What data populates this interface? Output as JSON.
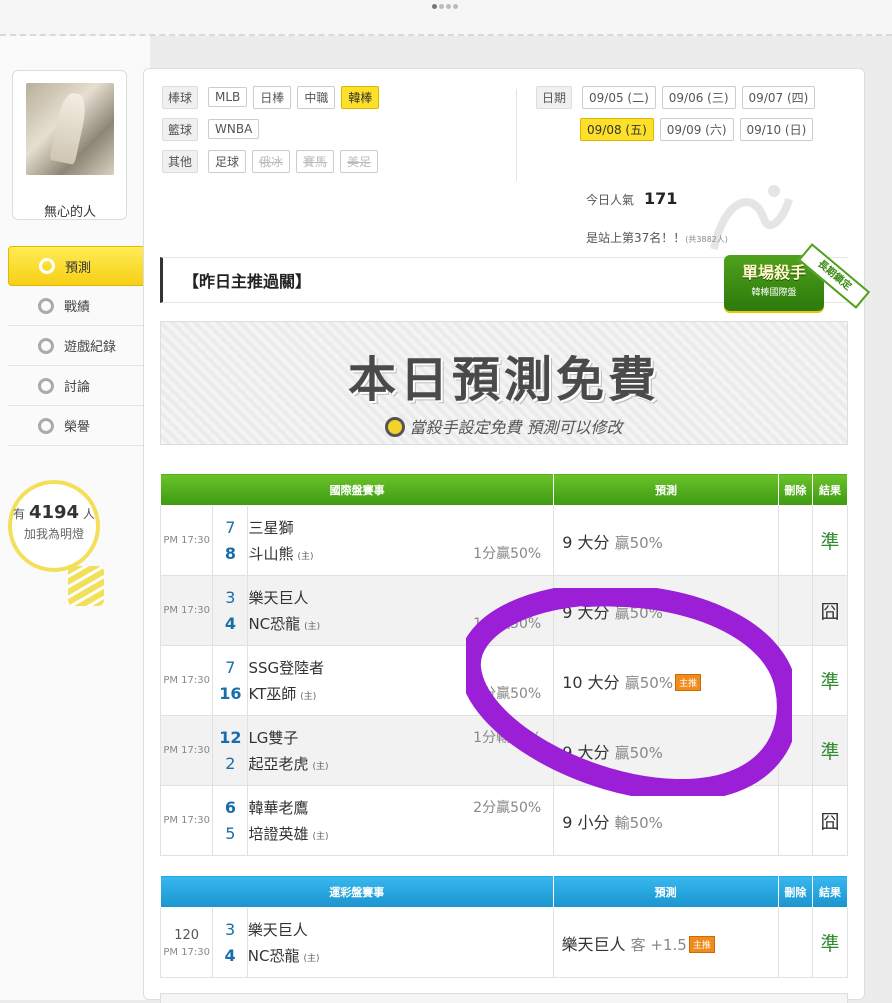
{
  "user": {
    "name": "無心的人"
  },
  "sidebar": {
    "items": [
      {
        "label": "預測",
        "icon": "target-icon",
        "active": true
      },
      {
        "label": "戰績",
        "icon": "trophy-icon",
        "active": false
      },
      {
        "label": "遊戲紀錄",
        "icon": "record-icon",
        "active": false
      },
      {
        "label": "討論",
        "icon": "discuss-icon",
        "active": false
      },
      {
        "label": "榮譽",
        "icon": "medal-icon",
        "active": false
      }
    ],
    "fans": {
      "prefix": "有",
      "count": "4194",
      "suffix": "人",
      "action": "加我為明燈"
    }
  },
  "filters": {
    "baseball": {
      "label": "棒球",
      "tags": [
        "MLB",
        "日棒",
        "中職",
        "韓棒"
      ],
      "selected": "韓棒"
    },
    "basketball": {
      "label": "籃球",
      "tags": [
        "WNBA"
      ]
    },
    "other": {
      "label": "其他",
      "tags": [
        "足球",
        "俄冰",
        "賽馬",
        "美足"
      ],
      "disabled": [
        "俄冰",
        "賽馬",
        "美足"
      ]
    }
  },
  "dates": {
    "label": "日期",
    "row1": [
      "09/05 (二)",
      "09/06 (三)",
      "09/07 (四)"
    ],
    "row2": [
      "09/08 (五)",
      "09/09 (六)",
      "09/10 (日)"
    ],
    "selected": "09/08 (五)"
  },
  "stats": {
    "popularity_label": "今日人氣",
    "popularity": "171",
    "rank_text": "是站上第37名！！",
    "rank_note": "(共3882人)"
  },
  "section": {
    "title": "【昨日主推過關】"
  },
  "killer_badge": {
    "title": "單場殺手",
    "subtitle": "韓棒國際盤",
    "ribbon": "長期鎖定"
  },
  "banner": {
    "title": "本日預測免費",
    "subtitle": "當殺手設定免費 預測可以修改"
  },
  "table1": {
    "headers": [
      "國際盤賽事",
      "預測",
      "刪除",
      "結果"
    ],
    "rows": [
      {
        "time": "PM 17:30",
        "away_score": "7",
        "home_score": "8",
        "away": "三星獅",
        "home": "斗山熊",
        "home_mark": "(主)",
        "odds": "1分贏50%",
        "odds_row": "home",
        "pred": "9 大分",
        "pred_pct": "贏50%",
        "main": false,
        "result": "準"
      },
      {
        "time": "PM 17:30",
        "away_score": "3",
        "home_score": "4",
        "away": "樂天巨人",
        "home": "NC恐龍",
        "home_mark": "(主)",
        "odds": "1分贏50%",
        "odds_row": "home",
        "pred": "9 大分",
        "pred_pct": "贏50%",
        "main": false,
        "result": "囧"
      },
      {
        "time": "PM 17:30",
        "away_score": "7",
        "home_score": "16",
        "away": "SSG登陸者",
        "home": "KT巫師",
        "home_mark": "(主)",
        "odds": "1分贏50%",
        "odds_row": "home",
        "pred": "10 大分",
        "pred_pct": "贏50%",
        "main": true,
        "result": "準"
      },
      {
        "time": "PM 17:30",
        "away_score": "12",
        "home_score": "2",
        "away": "LG雙子",
        "home": "起亞老虎",
        "home_mark": "(主)",
        "odds": "1分輸50%",
        "odds_row": "away",
        "pred": "9 大分",
        "pred_pct": "贏50%",
        "main": false,
        "result": "準"
      },
      {
        "time": "PM 17:30",
        "away_score": "6",
        "home_score": "5",
        "away": "韓華老鷹",
        "home": "培證英雄",
        "home_mark": "(主)",
        "odds": "2分贏50%",
        "odds_row": "away",
        "pred": "9 小分",
        "pred_pct": "輸50%",
        "main": false,
        "result": "囧"
      }
    ],
    "main_badge": "主推"
  },
  "table2": {
    "headers": [
      "運彩盤賽事",
      "預測",
      "刪除",
      "結果"
    ],
    "rows": [
      {
        "num": "120",
        "time": "PM 17:30",
        "away_score": "3",
        "home_score": "4",
        "away": "樂天巨人",
        "home": "NC恐龍",
        "home_mark": "(主)",
        "pred": "樂天巨人",
        "pred_pct": "客 +1.5",
        "main": true,
        "result": "準"
      }
    ]
  },
  "colors": {
    "accent_yellow": "#fde02a",
    "header_green": "#4fa11c",
    "header_blue": "#1a94cf",
    "annotation_purple": "#9b1fd6",
    "hit_green": "#2e8b2e"
  }
}
